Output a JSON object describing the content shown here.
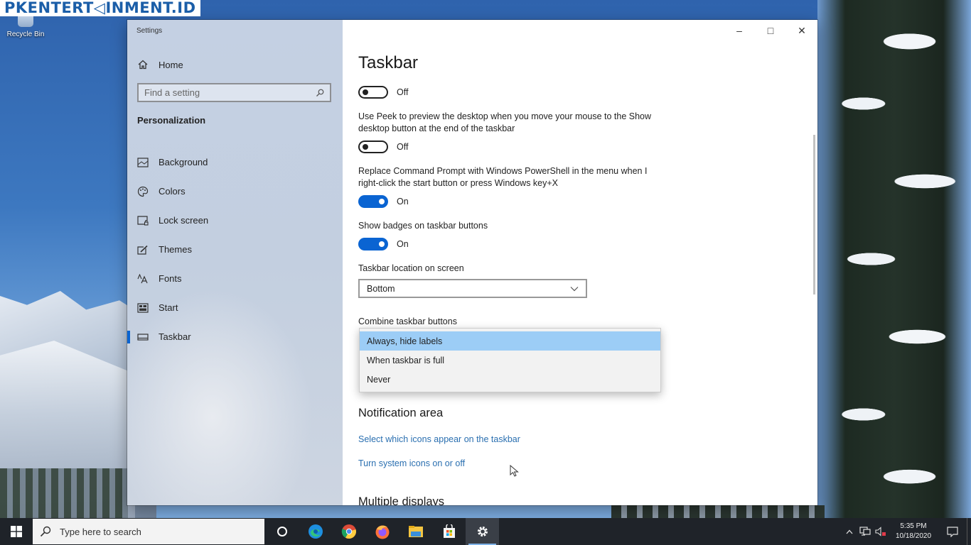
{
  "watermark": "PKENTERT◁INMENT.ID",
  "desktop": {
    "recycle_bin_label": "Recycle Bin"
  },
  "window": {
    "app_title": "Settings",
    "controls": {
      "minimize": "–",
      "maximize": "□",
      "close": "✕"
    }
  },
  "sidebar": {
    "home_label": "Home",
    "search_placeholder": "Find a setting",
    "section_title": "Personalization",
    "items": [
      {
        "label": "Background",
        "icon": "picture-icon",
        "active": false
      },
      {
        "label": "Colors",
        "icon": "palette-icon",
        "active": false
      },
      {
        "label": "Lock screen",
        "icon": "lock-screen-icon",
        "active": false
      },
      {
        "label": "Themes",
        "icon": "themes-icon",
        "active": false
      },
      {
        "label": "Fonts",
        "icon": "fonts-icon",
        "active": false
      },
      {
        "label": "Start",
        "icon": "start-icon",
        "active": false
      },
      {
        "label": "Taskbar",
        "icon": "taskbar-icon",
        "active": true
      }
    ]
  },
  "main": {
    "title": "Taskbar",
    "toggle1": {
      "state_label": "Off",
      "on": false
    },
    "peek": {
      "description": "Use Peek to preview the desktop when you move your mouse to the Show desktop button at the end of the taskbar",
      "state_label": "Off",
      "on": false
    },
    "powershell": {
      "description": "Replace Command Prompt with Windows PowerShell in the menu when I right-click the start button or press Windows key+X",
      "state_label": "On",
      "on": true
    },
    "badges": {
      "description": "Show badges on taskbar buttons",
      "state_label": "On",
      "on": true
    },
    "location": {
      "label": "Taskbar location on screen",
      "value": "Bottom"
    },
    "combine": {
      "label": "Combine taskbar buttons",
      "options": [
        "Always, hide labels",
        "When taskbar is full",
        "Never"
      ],
      "selected": "Always, hide labels"
    },
    "notification_area": {
      "heading": "Notification area",
      "links": [
        "Select which icons appear on the taskbar",
        "Turn system icons on or off"
      ]
    },
    "multiple_displays_heading": "Multiple displays"
  },
  "taskbar": {
    "search_placeholder": "Type here to search",
    "pinned": [
      "cortana-icon",
      "edge-icon",
      "chrome-icon",
      "firefox-icon",
      "file-explorer-icon",
      "store-icon",
      "settings-icon"
    ],
    "clock": {
      "time": "5:35 PM",
      "date": "10/18/2020"
    }
  },
  "colors": {
    "accent": "#0a64d2",
    "link": "#2a6fb0",
    "dropdown_selected": "#9ccdf6"
  }
}
